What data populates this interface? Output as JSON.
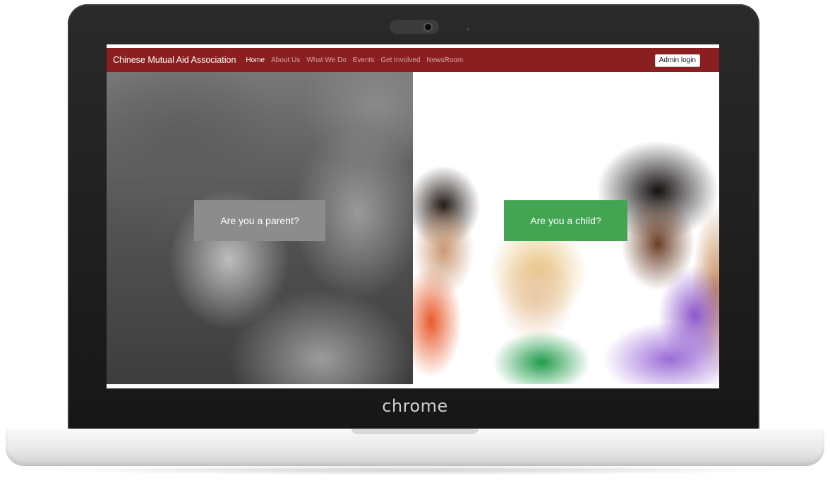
{
  "bezel": {
    "brand_text": "chrome"
  },
  "navbar": {
    "brand": "Chinese Mutual Aid Association",
    "links": [
      {
        "label": "Home",
        "active": true
      },
      {
        "label": "About Us",
        "active": false
      },
      {
        "label": "What We Do",
        "active": false
      },
      {
        "label": "Events",
        "active": false
      },
      {
        "label": "Get Involved",
        "active": false
      },
      {
        "label": "NewsRoom",
        "active": false
      }
    ],
    "admin_button": "Admin login",
    "background_color": "#8b1f1f"
  },
  "hero": {
    "parent_cta": "Are you a parent?",
    "child_cta": "Are you a child?",
    "parent_cta_color": "#8c8c8c",
    "child_cta_color": "#43a552",
    "parent_image": "grayscale-couple-photo",
    "child_image": "smiling-children-photo"
  }
}
